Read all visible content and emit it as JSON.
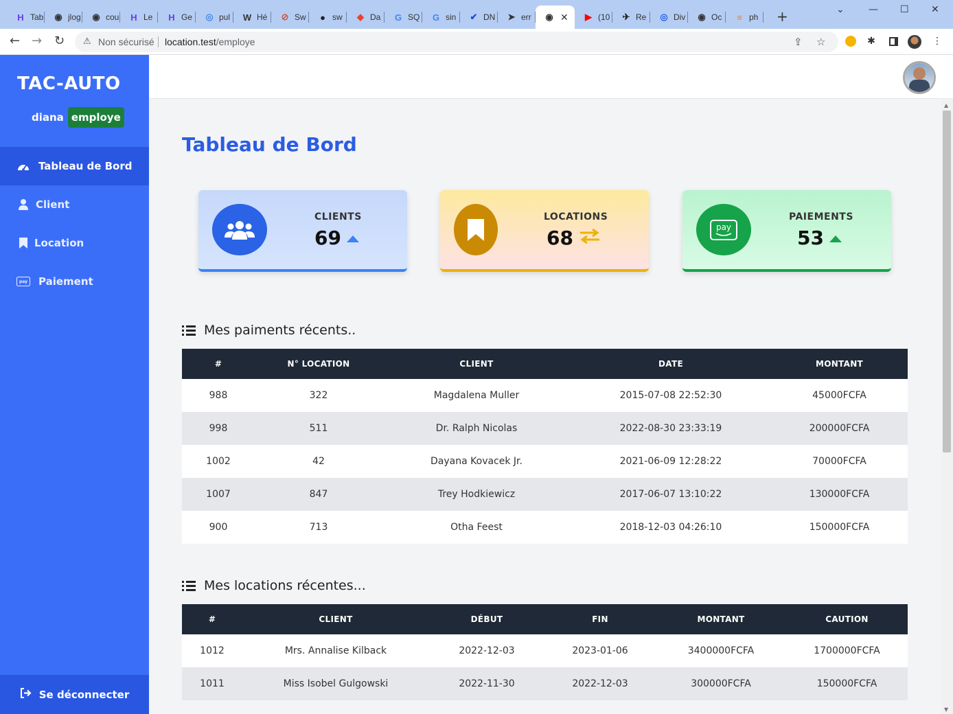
{
  "browser": {
    "tabs": [
      {
        "label": "Tab",
        "icon": "hostinger-icon",
        "color": "#673de6"
      },
      {
        "label": "jlog",
        "icon": "globe-icon",
        "color": "#333333"
      },
      {
        "label": "cou",
        "icon": "globe-icon",
        "color": "#333333"
      },
      {
        "label": "Le",
        "icon": "hostinger-icon",
        "color": "#673de6"
      },
      {
        "label": "Ge",
        "icon": "hostinger-icon",
        "color": "#673de6"
      },
      {
        "label": "pul",
        "icon": "app-icon",
        "color": "#4b8be8"
      },
      {
        "label": "Hé",
        "icon": "wikipedia-icon",
        "color": "#333333"
      },
      {
        "label": "Sw",
        "icon": "swagger-icon",
        "color": "#d0563b"
      },
      {
        "label": "sw",
        "icon": "github-icon",
        "color": "#222222"
      },
      {
        "label": "Da",
        "icon": "laravel-icon",
        "color": "#e74430"
      },
      {
        "label": "SQ",
        "icon": "google-icon",
        "color": "#4285f4"
      },
      {
        "label": "sin",
        "icon": "google-icon",
        "color": "#4285f4"
      },
      {
        "label": "DN",
        "icon": "checklist-icon",
        "color": "#1d4ed8"
      },
      {
        "label": "err",
        "icon": "send-icon",
        "color": "#333333"
      },
      {
        "label": "",
        "icon": "globe-icon",
        "color": "#333333",
        "active": true
      },
      {
        "label": "(10",
        "icon": "youtube-icon",
        "color": "#ff0000"
      },
      {
        "label": "Re",
        "icon": "bird-icon",
        "color": "#222222"
      },
      {
        "label": "Div",
        "icon": "app-icon",
        "color": "#2563eb"
      },
      {
        "label": "Oc",
        "icon": "globe-icon",
        "color": "#333333"
      },
      {
        "label": "ph",
        "icon": "stack-icon",
        "color": "#f48024"
      }
    ],
    "insecure_label": "Non sécurisé",
    "url_host": "location.test",
    "url_path": "/employe"
  },
  "sidebar": {
    "brand": "TAC-AUTO",
    "username": "diana",
    "role": "employe",
    "items": [
      {
        "label": "Tableau de Bord",
        "icon": "dashboard-icon",
        "active": true
      },
      {
        "label": "Client",
        "icon": "user-icon"
      },
      {
        "label": "Location",
        "icon": "bookmark-icon"
      },
      {
        "label": "Paiement",
        "icon": "pay-icon"
      }
    ],
    "logout": "Se déconnecter"
  },
  "main": {
    "title": "Tableau de Bord",
    "cards": [
      {
        "label": "CLIENTS",
        "value": "69",
        "icon": "users-icon",
        "trend": "up-triangle-icon",
        "accent": "#2a63e6",
        "trend_color": "#3b82f6"
      },
      {
        "label": "LOCATIONS",
        "value": "68",
        "icon": "bookmark-icon",
        "trend": "exchange-arrows-icon",
        "accent": "#ca8a04",
        "trend_color": "#eab308"
      },
      {
        "label": "PAIEMENTS",
        "value": "53",
        "icon": "amazon-pay-icon",
        "trend": "up-triangle-icon",
        "accent": "#16a34a",
        "trend_color": "#16a34a"
      }
    ],
    "payments": {
      "title": "Mes paiments récents..",
      "columns": [
        "#",
        "N° LOCATION",
        "CLIENT",
        "DATE",
        "MONTANT"
      ],
      "rows": [
        [
          "988",
          "322",
          "Magdalena Muller",
          "2015-07-08 22:52:30",
          "45000FCFA"
        ],
        [
          "998",
          "511",
          "Dr. Ralph Nicolas",
          "2022-08-30 23:33:19",
          "200000FCFA"
        ],
        [
          "1002",
          "42",
          "Dayana Kovacek Jr.",
          "2021-06-09 12:28:22",
          "70000FCFA"
        ],
        [
          "1007",
          "847",
          "Trey Hodkiewicz",
          "2017-06-07 13:10:22",
          "130000FCFA"
        ],
        [
          "900",
          "713",
          "Otha Feest",
          "2018-12-03 04:26:10",
          "150000FCFA"
        ]
      ]
    },
    "locations": {
      "title": "Mes locations récentes...",
      "columns": [
        "#",
        "CLIENT",
        "DÉBUT",
        "FIN",
        "MONTANT",
        "CAUTION"
      ],
      "rows": [
        [
          "1012",
          "Mrs. Annalise Kilback",
          "2022-12-03",
          "2023-01-06",
          "3400000FCFA",
          "1700000FCFA"
        ],
        [
          "1011",
          "Miss Isobel Gulgowski",
          "2022-11-30",
          "2022-12-03",
          "300000FCFA",
          "150000FCFA"
        ]
      ]
    }
  }
}
